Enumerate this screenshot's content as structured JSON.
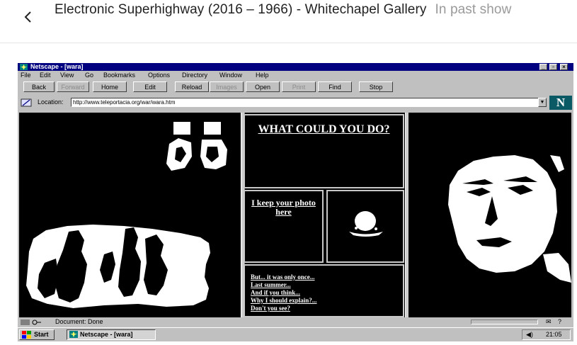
{
  "header": {
    "title": "Electronic Superhighway (2016 – 1966) - Whitechapel Gallery",
    "status": "In past show",
    "back_icon": "chevron-left-icon"
  },
  "browser": {
    "window_title": "Netscape - [wara]",
    "menu": [
      "File",
      "Edit",
      "View",
      "Go",
      "Bookmarks",
      "Options",
      "Directory",
      "Window",
      "Help"
    ],
    "toolbar": {
      "back": "Back",
      "forward": "Forward",
      "home": "Home",
      "edit": "Edit",
      "reload": "Reload",
      "images": "Images",
      "open": "Open",
      "print": "Print",
      "find": "Find",
      "stop": "Stop"
    },
    "location_label": "Location:",
    "url": "http://www.teleportacia.org/war/wara.htm",
    "logo_letter": "N"
  },
  "page": {
    "heading": "WHAT COULD YOU DO?",
    "photo_link": "I keep your photo here",
    "questions": [
      "But... it was only once...",
      "Last summer...",
      "And if you think...",
      "Why I should explain?...",
      "Don't you see?"
    ]
  },
  "status": {
    "text": "Document: Done"
  },
  "taskbar": {
    "start": "Start",
    "task": "Netscape - [wara]",
    "clock": "21:05"
  },
  "colors": {
    "titlebar": "#000080",
    "chrome": "#c0c0c0",
    "page_bg": "#000000",
    "link": "#ffffff"
  }
}
